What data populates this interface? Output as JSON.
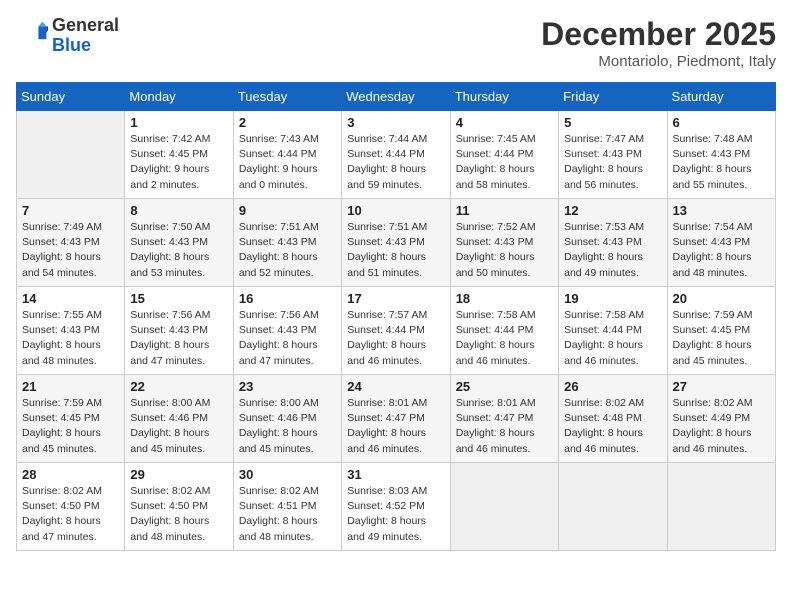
{
  "header": {
    "logo_line1": "General",
    "logo_line2": "Blue",
    "month_title": "December 2025",
    "location": "Montariolo, Piedmont, Italy"
  },
  "days_of_week": [
    "Sunday",
    "Monday",
    "Tuesday",
    "Wednesday",
    "Thursday",
    "Friday",
    "Saturday"
  ],
  "weeks": [
    [
      {
        "day": "",
        "lines": []
      },
      {
        "day": "1",
        "lines": [
          "Sunrise: 7:42 AM",
          "Sunset: 4:45 PM",
          "Daylight: 9 hours",
          "and 2 minutes."
        ]
      },
      {
        "day": "2",
        "lines": [
          "Sunrise: 7:43 AM",
          "Sunset: 4:44 PM",
          "Daylight: 9 hours",
          "and 0 minutes."
        ]
      },
      {
        "day": "3",
        "lines": [
          "Sunrise: 7:44 AM",
          "Sunset: 4:44 PM",
          "Daylight: 8 hours",
          "and 59 minutes."
        ]
      },
      {
        "day": "4",
        "lines": [
          "Sunrise: 7:45 AM",
          "Sunset: 4:44 PM",
          "Daylight: 8 hours",
          "and 58 minutes."
        ]
      },
      {
        "day": "5",
        "lines": [
          "Sunrise: 7:47 AM",
          "Sunset: 4:43 PM",
          "Daylight: 8 hours",
          "and 56 minutes."
        ]
      },
      {
        "day": "6",
        "lines": [
          "Sunrise: 7:48 AM",
          "Sunset: 4:43 PM",
          "Daylight: 8 hours",
          "and 55 minutes."
        ]
      }
    ],
    [
      {
        "day": "7",
        "lines": [
          "Sunrise: 7:49 AM",
          "Sunset: 4:43 PM",
          "Daylight: 8 hours",
          "and 54 minutes."
        ]
      },
      {
        "day": "8",
        "lines": [
          "Sunrise: 7:50 AM",
          "Sunset: 4:43 PM",
          "Daylight: 8 hours",
          "and 53 minutes."
        ]
      },
      {
        "day": "9",
        "lines": [
          "Sunrise: 7:51 AM",
          "Sunset: 4:43 PM",
          "Daylight: 8 hours",
          "and 52 minutes."
        ]
      },
      {
        "day": "10",
        "lines": [
          "Sunrise: 7:51 AM",
          "Sunset: 4:43 PM",
          "Daylight: 8 hours",
          "and 51 minutes."
        ]
      },
      {
        "day": "11",
        "lines": [
          "Sunrise: 7:52 AM",
          "Sunset: 4:43 PM",
          "Daylight: 8 hours",
          "and 50 minutes."
        ]
      },
      {
        "day": "12",
        "lines": [
          "Sunrise: 7:53 AM",
          "Sunset: 4:43 PM",
          "Daylight: 8 hours",
          "and 49 minutes."
        ]
      },
      {
        "day": "13",
        "lines": [
          "Sunrise: 7:54 AM",
          "Sunset: 4:43 PM",
          "Daylight: 8 hours",
          "and 48 minutes."
        ]
      }
    ],
    [
      {
        "day": "14",
        "lines": [
          "Sunrise: 7:55 AM",
          "Sunset: 4:43 PM",
          "Daylight: 8 hours",
          "and 48 minutes."
        ]
      },
      {
        "day": "15",
        "lines": [
          "Sunrise: 7:56 AM",
          "Sunset: 4:43 PM",
          "Daylight: 8 hours",
          "and 47 minutes."
        ]
      },
      {
        "day": "16",
        "lines": [
          "Sunrise: 7:56 AM",
          "Sunset: 4:43 PM",
          "Daylight: 8 hours",
          "and 47 minutes."
        ]
      },
      {
        "day": "17",
        "lines": [
          "Sunrise: 7:57 AM",
          "Sunset: 4:44 PM",
          "Daylight: 8 hours",
          "and 46 minutes."
        ]
      },
      {
        "day": "18",
        "lines": [
          "Sunrise: 7:58 AM",
          "Sunset: 4:44 PM",
          "Daylight: 8 hours",
          "and 46 minutes."
        ]
      },
      {
        "day": "19",
        "lines": [
          "Sunrise: 7:58 AM",
          "Sunset: 4:44 PM",
          "Daylight: 8 hours",
          "and 46 minutes."
        ]
      },
      {
        "day": "20",
        "lines": [
          "Sunrise: 7:59 AM",
          "Sunset: 4:45 PM",
          "Daylight: 8 hours",
          "and 45 minutes."
        ]
      }
    ],
    [
      {
        "day": "21",
        "lines": [
          "Sunrise: 7:59 AM",
          "Sunset: 4:45 PM",
          "Daylight: 8 hours",
          "and 45 minutes."
        ]
      },
      {
        "day": "22",
        "lines": [
          "Sunrise: 8:00 AM",
          "Sunset: 4:46 PM",
          "Daylight: 8 hours",
          "and 45 minutes."
        ]
      },
      {
        "day": "23",
        "lines": [
          "Sunrise: 8:00 AM",
          "Sunset: 4:46 PM",
          "Daylight: 8 hours",
          "and 45 minutes."
        ]
      },
      {
        "day": "24",
        "lines": [
          "Sunrise: 8:01 AM",
          "Sunset: 4:47 PM",
          "Daylight: 8 hours",
          "and 46 minutes."
        ]
      },
      {
        "day": "25",
        "lines": [
          "Sunrise: 8:01 AM",
          "Sunset: 4:47 PM",
          "Daylight: 8 hours",
          "and 46 minutes."
        ]
      },
      {
        "day": "26",
        "lines": [
          "Sunrise: 8:02 AM",
          "Sunset: 4:48 PM",
          "Daylight: 8 hours",
          "and 46 minutes."
        ]
      },
      {
        "day": "27",
        "lines": [
          "Sunrise: 8:02 AM",
          "Sunset: 4:49 PM",
          "Daylight: 8 hours",
          "and 46 minutes."
        ]
      }
    ],
    [
      {
        "day": "28",
        "lines": [
          "Sunrise: 8:02 AM",
          "Sunset: 4:50 PM",
          "Daylight: 8 hours",
          "and 47 minutes."
        ]
      },
      {
        "day": "29",
        "lines": [
          "Sunrise: 8:02 AM",
          "Sunset: 4:50 PM",
          "Daylight: 8 hours",
          "and 48 minutes."
        ]
      },
      {
        "day": "30",
        "lines": [
          "Sunrise: 8:02 AM",
          "Sunset: 4:51 PM",
          "Daylight: 8 hours",
          "and 48 minutes."
        ]
      },
      {
        "day": "31",
        "lines": [
          "Sunrise: 8:03 AM",
          "Sunset: 4:52 PM",
          "Daylight: 8 hours",
          "and 49 minutes."
        ]
      },
      {
        "day": "",
        "lines": []
      },
      {
        "day": "",
        "lines": []
      },
      {
        "day": "",
        "lines": []
      }
    ]
  ]
}
